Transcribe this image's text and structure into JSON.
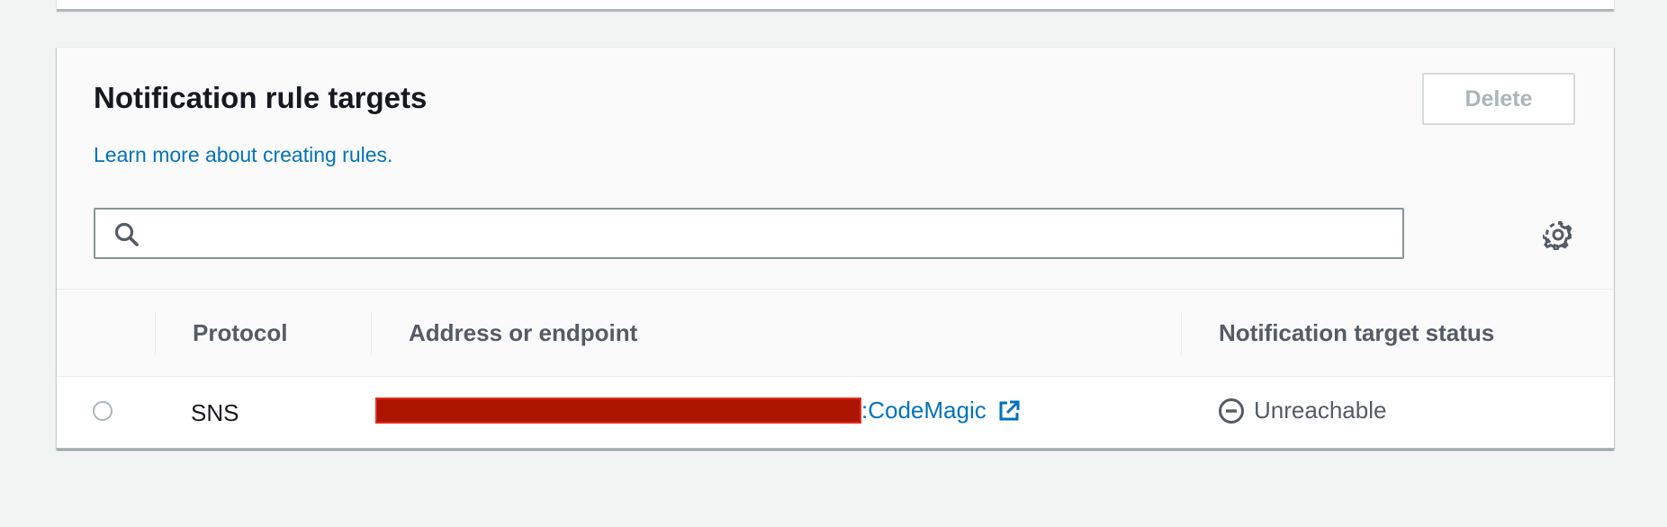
{
  "panel": {
    "title": "Notification rule targets",
    "learn_more_link": "Learn more about creating rules.",
    "delete_button": "Delete"
  },
  "search": {
    "placeholder": "",
    "value": "",
    "icon": "search-icon"
  },
  "preferences_icon": "gear-icon",
  "table": {
    "columns": [
      "Protocol",
      "Address or endpoint",
      "Notification target status"
    ],
    "rows": [
      {
        "selected": false,
        "protocol": "SNS",
        "endpoint_visible_suffix": ":CodeMagic",
        "endpoint_redacted": true,
        "endpoint_icon": "external-link-icon",
        "status": "Unreachable",
        "status_icon": "minus-circle-icon"
      }
    ]
  },
  "colors": {
    "link": "#0073bb",
    "title": "#16191f",
    "muted": "#545b64",
    "disabled": "#aab7b8",
    "redaction": "#ad1400",
    "background": "#f2f3f3"
  }
}
